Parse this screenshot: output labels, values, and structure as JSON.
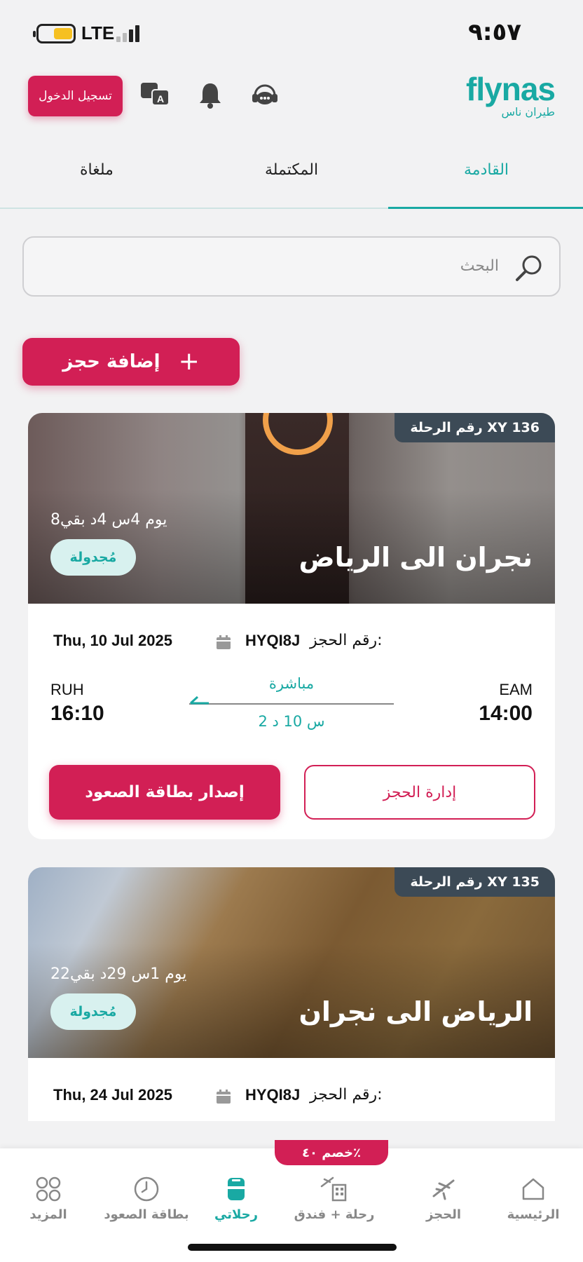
{
  "status_bar": {
    "network": "LTE",
    "time": "٩:٥٧"
  },
  "header": {
    "login_label": "تسجيل الدخول",
    "logo_en": "flynas",
    "logo_ar": "طيران ناس"
  },
  "tabs": [
    {
      "label": "القادمة",
      "active": true
    },
    {
      "label": "المكتملة",
      "active": false
    },
    {
      "label": "ملغاة",
      "active": false
    }
  ],
  "search": {
    "placeholder": "البحث"
  },
  "add_booking_label": "إضافة حجز",
  "trips": [
    {
      "flight_label": "رقم الرحلة XY 136",
      "remaining": "8يوم 4س 4د بقي",
      "status": "مُجدولة",
      "route": "نجران الى الرياض",
      "ref_label": "رقم الحجز:",
      "ref_code": "HYQI8J",
      "date": "Thu, 10 Jul 2025",
      "from_code": "EAM",
      "from_time": "14:00",
      "to_code": "RUH",
      "to_time": "16:10",
      "stops": "مباشرة",
      "duration": "2 س 10 د",
      "manage_label": "إدارة الحجز",
      "boarding_label": "إصدار بطاقة الصعود"
    },
    {
      "flight_label": "رقم الرحلة XY 135",
      "remaining": "22يوم 1س 29د بقي",
      "status": "مُجدولة",
      "route": "الرياض الى نجران",
      "ref_label": "رقم الحجز:",
      "ref_code": "HYQI8J",
      "date": "Thu, 24 Jul 2025"
    }
  ],
  "promo": "خصم ٤٠٪",
  "bottom_nav": [
    {
      "label": "الرئيسية",
      "icon": "home-icon"
    },
    {
      "label": "الحجز",
      "icon": "plane-icon"
    },
    {
      "label": "رحلة + فندق",
      "icon": "plane-hotel-icon"
    },
    {
      "label": "رحلاتي",
      "icon": "luggage-icon",
      "active": true
    },
    {
      "label": "بطاقة الصعود",
      "icon": "clock-icon"
    },
    {
      "label": "المزيد",
      "icon": "grid-icon"
    }
  ],
  "colors": {
    "brand": "#19a9a3",
    "accent": "#d21f55"
  }
}
